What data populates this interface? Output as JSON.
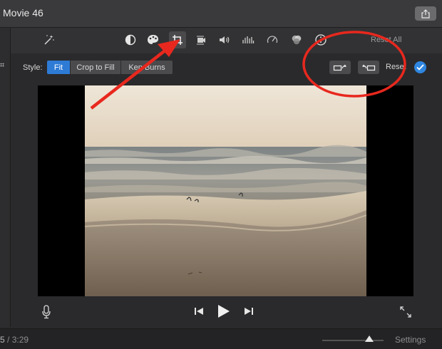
{
  "window": {
    "title": "Movie 46"
  },
  "toolbar": {
    "tools": [
      {
        "name": "color-balance",
        "label": "Color balance"
      },
      {
        "name": "color-correction",
        "label": "Color correction"
      },
      {
        "name": "cropping",
        "label": "Cropping"
      },
      {
        "name": "stabilization",
        "label": "Stabilization"
      },
      {
        "name": "volume",
        "label": "Volume"
      },
      {
        "name": "noise-reduction",
        "label": "Noise reduction and equalizer"
      },
      {
        "name": "speed",
        "label": "Speed"
      },
      {
        "name": "clip-filter",
        "label": "Clip filter"
      },
      {
        "name": "clip-info",
        "label": "Clip information"
      }
    ],
    "reset_all": "Reset All"
  },
  "style_bar": {
    "label": "Style:",
    "options": [
      "Fit",
      "Crop to Fill",
      "Ken Burns"
    ],
    "selected": "Fit",
    "reset": "Reset"
  },
  "timeline": {
    "current_time": "5",
    "separator": " / ",
    "total_time": "3:29",
    "settings": "Settings"
  },
  "colors": {
    "accent": "#2e7bd6",
    "annotation": "#e8281e"
  }
}
